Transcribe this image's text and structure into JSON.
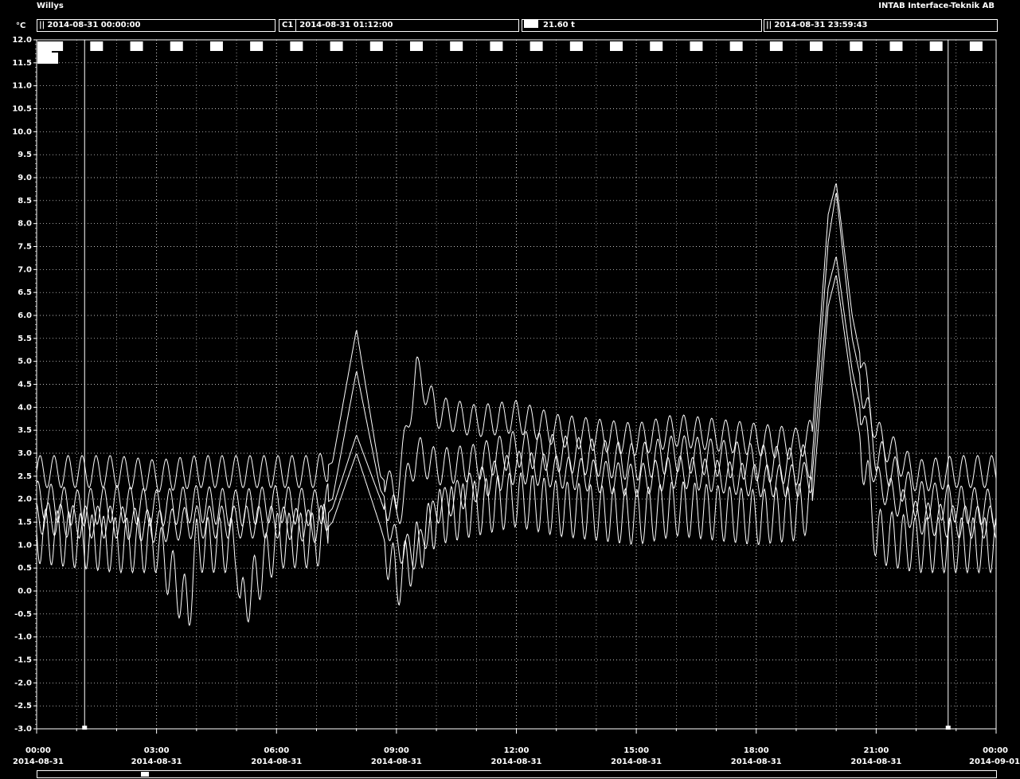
{
  "header": {
    "title_left": "Willys",
    "title_right": "INTAB Interface-Teknik AB",
    "unit": "°C"
  },
  "readouts": {
    "start_time": "2014-08-31 00:00:00",
    "cursor_label": "C1",
    "cursor_time": "2014-08-31 01:12:00",
    "span": "21.60 t",
    "end_time": "2014-08-31 23:59:43"
  },
  "colors": {
    "background": "#000000",
    "foreground": "#ffffff"
  },
  "chart_data": {
    "type": "line",
    "title": "",
    "xlabel": "",
    "ylabel": "°C",
    "xlim_hours": [
      0,
      24
    ],
    "ylim": [
      -3.0,
      12.0
    ],
    "grid": true,
    "yticks": [
      "12.0",
      "11.5",
      "11.0",
      "10.5",
      "10.0",
      "9.5",
      "9.0",
      "8.5",
      "8.0",
      "7.5",
      "7.0",
      "6.5",
      "6.0",
      "5.5",
      "5.0",
      "4.5",
      "4.0",
      "3.5",
      "3.0",
      "2.5",
      "2.0",
      "1.5",
      "1.0",
      "0.5",
      "0.0",
      "-0.5",
      "-1.0",
      "-1.5",
      "-2.0",
      "-2.5",
      "-3.0"
    ],
    "xticks": [
      {
        "time": "00:00",
        "date": "2014-08-31"
      },
      {
        "time": "03:00",
        "date": "2014-08-31"
      },
      {
        "time": "06:00",
        "date": "2014-08-31"
      },
      {
        "time": "09:00",
        "date": "2014-08-31"
      },
      {
        "time": "12:00",
        "date": "2014-08-31"
      },
      {
        "time": "15:00",
        "date": "2014-08-31"
      },
      {
        "time": "18:00",
        "date": "2014-08-31"
      },
      {
        "time": "21:00",
        "date": "2014-08-31"
      },
      {
        "time": "00:00",
        "date": "2014-09-01"
      }
    ],
    "cursors_hours": [
      1.2,
      22.8
    ],
    "series": [
      {
        "x": [
          0,
          1,
          2,
          3,
          4,
          5,
          6,
          7,
          7.4,
          8.0,
          8.6,
          9.0,
          9.5,
          10,
          11,
          12,
          13,
          14,
          15,
          16,
          17,
          18,
          19,
          19.4,
          19.8,
          20.0,
          20.4,
          21,
          22,
          23,
          24
        ],
        "y": [
          2.6,
          2.6,
          2.6,
          2.5,
          2.6,
          2.6,
          2.6,
          2.6,
          2.8,
          5.7,
          2.5,
          2.1,
          4.8,
          3.9,
          3.7,
          3.8,
          3.5,
          3.4,
          3.3,
          3.5,
          3.4,
          3.3,
          3.2,
          3.4,
          8.2,
          8.9,
          6.0,
          3.4,
          2.5,
          2.6,
          2.6
        ]
      },
      {
        "x": [
          0,
          1,
          2,
          3,
          4,
          5,
          6,
          7,
          7.4,
          8.0,
          8.6,
          9.0,
          9.5,
          10,
          11,
          12,
          13,
          14,
          15,
          16,
          17,
          18,
          19,
          19.4,
          19.8,
          20.0,
          20.4,
          21,
          22,
          23,
          24
        ],
        "y": [
          2.0,
          1.8,
          1.9,
          1.8,
          1.9,
          1.8,
          1.9,
          1.8,
          2.0,
          4.8,
          2.2,
          1.6,
          3.0,
          2.7,
          2.8,
          3.1,
          3.0,
          2.9,
          2.8,
          3.0,
          2.9,
          2.8,
          2.7,
          2.9,
          7.6,
          8.7,
          5.5,
          3.0,
          2.0,
          1.9,
          1.8
        ]
      },
      {
        "x": [
          0,
          1,
          2,
          3,
          4,
          5,
          6,
          7,
          7.4,
          8.0,
          8.6,
          9.0,
          9.5,
          10,
          11,
          12,
          13,
          14,
          15,
          16,
          17,
          18,
          19,
          19.4,
          19.8,
          20.0,
          20.4,
          21,
          22,
          23,
          24
        ],
        "y": [
          1.6,
          1.5,
          1.5,
          1.4,
          1.5,
          1.5,
          1.5,
          1.4,
          1.8,
          3.4,
          2.0,
          1.0,
          0.8,
          1.8,
          2.3,
          2.7,
          2.6,
          2.5,
          2.4,
          2.6,
          2.5,
          2.4,
          2.4,
          2.5,
          6.6,
          7.3,
          4.8,
          2.4,
          1.6,
          1.5,
          1.5
        ]
      },
      {
        "x": [
          0,
          1,
          2,
          3,
          3.8,
          4,
          5,
          5.1,
          6,
          7,
          7.4,
          8.0,
          8.6,
          9.0,
          9.5,
          10,
          11,
          12,
          13,
          14,
          15,
          16,
          17,
          18,
          19,
          19.4,
          19.8,
          20.0,
          20.4,
          21,
          22,
          23,
          24
        ],
        "y": [
          1.2,
          1.1,
          1.0,
          1.0,
          -0.4,
          1.0,
          1.0,
          -0.4,
          1.1,
          1.1,
          1.5,
          3.0,
          1.4,
          0.2,
          0.9,
          1.6,
          1.8,
          2.0,
          1.8,
          1.7,
          1.6,
          1.8,
          1.7,
          1.6,
          1.7,
          1.9,
          6.2,
          6.9,
          4.4,
          1.2,
          1.0,
          1.0,
          1.0
        ]
      }
    ]
  }
}
